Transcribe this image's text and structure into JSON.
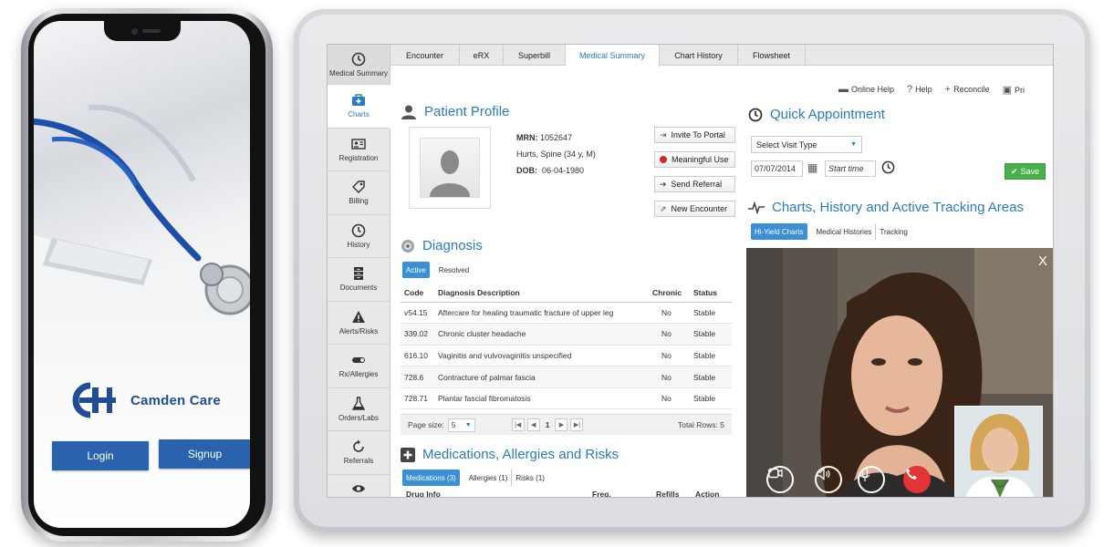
{
  "phone": {
    "brand_name": "Camden Care",
    "login_label": "Login",
    "signup_label": "Signup",
    "brand_color": "#1f4e93",
    "button_color": "#2a62ad"
  },
  "sidebar": {
    "items": [
      {
        "label": "Medical Summary",
        "icon": "clock-icon"
      },
      {
        "label": "Charts",
        "icon": "medical-kit-icon",
        "active": true
      },
      {
        "label": "Registration",
        "icon": "id-card-icon"
      },
      {
        "label": "Billing",
        "icon": "tag-icon"
      },
      {
        "label": "History",
        "icon": "clock-icon"
      },
      {
        "label": "Documents",
        "icon": "cabinet-icon"
      },
      {
        "label": "Alerts/Risks",
        "icon": "warning-icon"
      },
      {
        "label": "Rx/Allergies",
        "icon": "toggle-icon"
      },
      {
        "label": "Orders/Labs",
        "icon": "flask-icon"
      },
      {
        "label": "Referrals",
        "icon": "refresh-icon"
      },
      {
        "label": "",
        "icon": "eye-icon"
      }
    ]
  },
  "tabs": [
    "Encounter",
    "eRX",
    "Superbill",
    "Medical Summary",
    "Chart History",
    "Flowsheet"
  ],
  "active_tab": "Medical Summary",
  "toplinks": {
    "online_help": "Online Help",
    "help": "Help",
    "reconcile": "Reconcile",
    "print": "Pri"
  },
  "profile": {
    "title": "Patient Profile",
    "mrn_label": "MRN:",
    "mrn": "1052647",
    "name": "Hurts, Spine (34 y, M)",
    "dob_label": "DOB:",
    "dob": "06-04-1980",
    "buttons": {
      "invite": "Invite To Portal",
      "meaningful": "Meaningful Use",
      "referral": "Send Referral",
      "encounter": "New Encounter"
    }
  },
  "diagnosis": {
    "title": "Diagnosis",
    "tabs": [
      "Active",
      "Resolved"
    ],
    "columns": [
      "Code",
      "Diagnosis Description",
      "Chronic",
      "Status"
    ],
    "rows": [
      [
        "v54.15",
        "Aftercare for healing traumatic fracture of upper leg",
        "No",
        "Stable"
      ],
      [
        "339.02",
        "Chronic cluster headache",
        "No",
        "Stable"
      ],
      [
        "616.10",
        "Vaginitis and vulvovaginitis unspecified",
        "No",
        "Stable"
      ],
      [
        "728.6",
        "Contracture of palmar fascia",
        "No",
        "Stable"
      ],
      [
        "728.71",
        "Plantar fascial fibromatosis",
        "No",
        "Stable"
      ]
    ],
    "page_size_label": "Page size:",
    "page_size": "5",
    "page": "1",
    "total": "Total Rows: 5"
  },
  "medications": {
    "title": "Medications, Allergies and Risks",
    "tabs": [
      "Medications (3)",
      "Allergies (1)",
      "Risks (1)"
    ],
    "columns": [
      "Drug Info",
      "Freq.",
      "Refills",
      "Action"
    ]
  },
  "quick_appt": {
    "title": "Quick Appointment",
    "visit_type": "Select Visit Type",
    "date": "07/07/2014",
    "time_placeholder": "Start time",
    "save": "Save"
  },
  "tracking": {
    "title": "Charts, History and Active Tracking Areas",
    "tabs": [
      "Hi-Yield Charts",
      "Medical Histories",
      "Tracking"
    ]
  },
  "video": {
    "close": "X"
  },
  "colors": {
    "accent": "#2a7cc0",
    "save_green": "#49b04b",
    "end_call_red": "#e23434"
  }
}
